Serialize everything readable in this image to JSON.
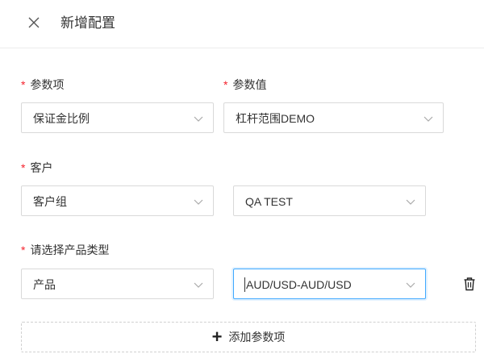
{
  "header": {
    "title": "新增配置"
  },
  "form": {
    "required_mark": "*",
    "param_item": {
      "label": "参数项",
      "value": "保证金比例"
    },
    "param_value": {
      "label": "参数值",
      "value": "杠杆范围DEMO"
    },
    "customer": {
      "label": "客户",
      "type_value": "客户组",
      "value": "QA TEST"
    },
    "product": {
      "label": "请选择产品类型",
      "type_value": "产品",
      "value": "AUD/USD-AUD/USD"
    },
    "add_button": {
      "label": "添加参数项"
    }
  },
  "colors": {
    "required": "#f5222d",
    "focus_border": "#40a9ff",
    "border": "#d9d9d9"
  },
  "icons": [
    "close-icon",
    "chevron-down-icon",
    "trash-icon",
    "plus-icon"
  ]
}
